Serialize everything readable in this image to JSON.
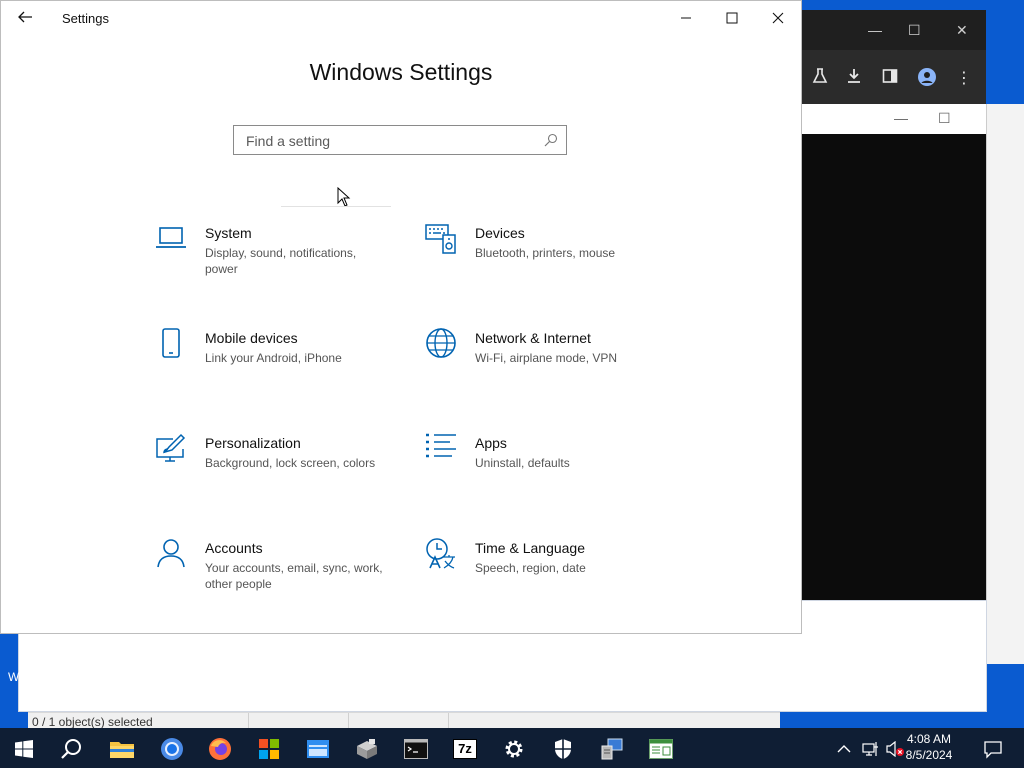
{
  "settings": {
    "window_title": "Settings",
    "heading": "Windows Settings",
    "search_placeholder": "Find a setting",
    "tiles": [
      {
        "name": "System",
        "desc": "Display, sound, notifications, power"
      },
      {
        "name": "Devices",
        "desc": "Bluetooth, printers, mouse"
      },
      {
        "name": "Mobile devices",
        "desc": "Link your Android, iPhone"
      },
      {
        "name": "Network & Internet",
        "desc": "Wi-Fi, airplane mode, VPN"
      },
      {
        "name": "Personalization",
        "desc": "Background, lock screen, colors"
      },
      {
        "name": "Apps",
        "desc": "Uninstall, defaults"
      },
      {
        "name": "Accounts",
        "desc": "Your accounts, email, sync, work, other people"
      },
      {
        "name": "Time & Language",
        "desc": "Speech, region, date"
      }
    ]
  },
  "explorer": {
    "status": "0 / 1 object(s) selected"
  },
  "background_left_letter": "W",
  "taskbar": {
    "time": "4:08 AM",
    "date": "8/5/2024",
    "app_7zip_label": "7z"
  },
  "colors": {
    "accent": "#0063b1",
    "taskbar": "#0f1e34",
    "desktop": "#0a5bd0"
  }
}
